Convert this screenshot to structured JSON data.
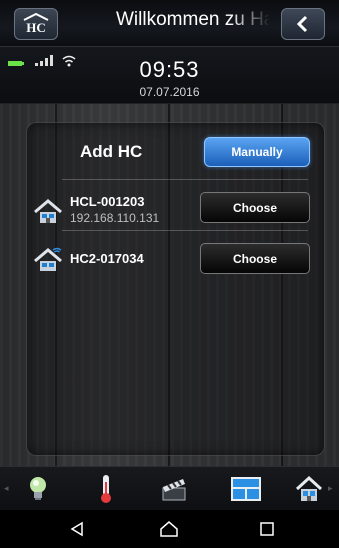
{
  "header": {
    "title": "Willkommen zu Ha"
  },
  "status": {
    "time": "09:53",
    "date": "07.07.2016"
  },
  "main": {
    "add_label": "Add HC",
    "manually_label": "Manually",
    "devices": [
      {
        "name": "HCL-001203",
        "ip": "192.168.110.131",
        "choose_label": "Choose",
        "icon": "house-icon"
      },
      {
        "name": "HC2-017034",
        "ip": "",
        "choose_label": "Choose",
        "icon": "house-wifi-icon"
      }
    ]
  },
  "tabs": [
    {
      "name": "lightbulb-icon"
    },
    {
      "name": "thermometer-icon"
    },
    {
      "name": "scene-clapper-icon"
    },
    {
      "name": "window-blinds-icon"
    },
    {
      "name": "house-icon"
    }
  ],
  "nav": [
    "back-triangle-icon",
    "home-outline-icon",
    "recents-square-icon"
  ],
  "colors": {
    "accent": "#2f7fd9",
    "battery": "#6be24a"
  }
}
